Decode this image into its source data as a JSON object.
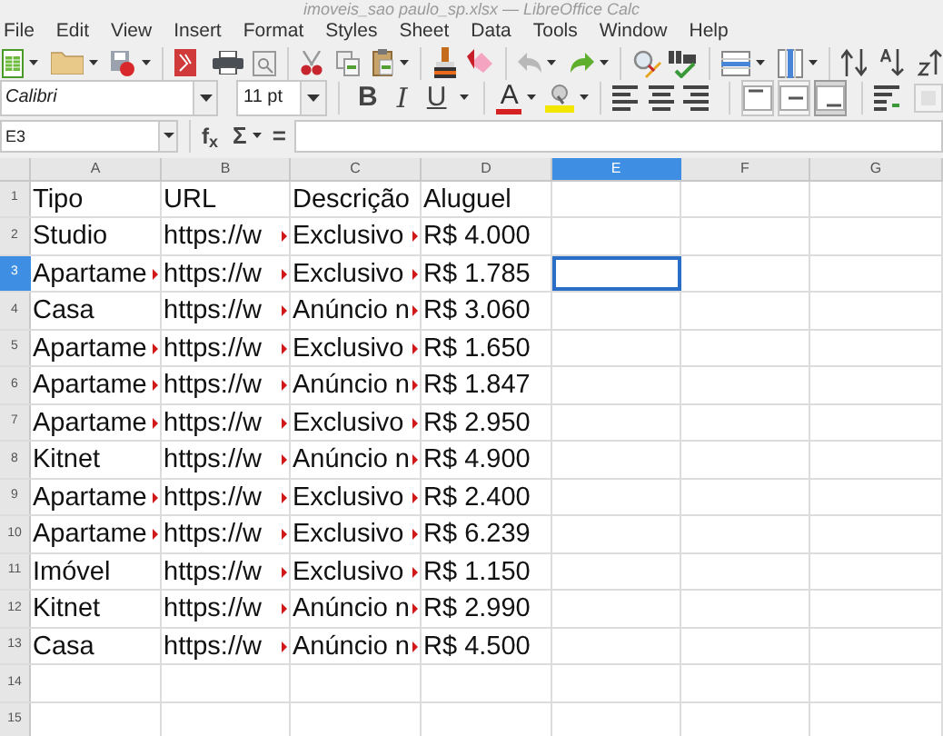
{
  "window": {
    "title": "imoveis_sao paulo_sp.xlsx — LibreOffice Calc"
  },
  "menu": [
    "File",
    "Edit",
    "View",
    "Insert",
    "Format",
    "Styles",
    "Sheet",
    "Data",
    "Tools",
    "Window",
    "Help"
  ],
  "toolbar": {
    "font_name": "Calibri",
    "font_size": "11 pt",
    "format_buttons": [
      {
        "label": "B",
        "kind": "bold"
      },
      {
        "label": "I",
        "kind": "italic"
      },
      {
        "label": "U",
        "kind": "underline"
      }
    ],
    "font_color_label": "A",
    "vertical_align": [
      {
        "selected": false
      },
      {
        "selected": false
      },
      {
        "selected": true
      }
    ]
  },
  "formula_bar": {
    "name_box": "E3",
    "function_wizard": "f$_{x}$",
    "sum": "Σ",
    "equals": "="
  },
  "sheet": {
    "columns": [
      {
        "label": "A",
        "selected": false
      },
      {
        "label": "B",
        "selected": false
      },
      {
        "label": "C",
        "selected": false
      },
      {
        "label": "D",
        "selected": false
      },
      {
        "label": "E",
        "selected": true
      },
      {
        "label": "F",
        "selected": false
      },
      {
        "label": "G",
        "selected": false
      }
    ],
    "rows": [
      {
        "number": "1",
        "selected": false,
        "cells": [
          {
            "text": "Tipo",
            "clipped": false
          },
          {
            "text": "URL",
            "clipped": false
          },
          {
            "text": "Descrição",
            "clipped": false
          },
          {
            "text": "Aluguel",
            "clipped": false
          }
        ]
      },
      {
        "number": "2",
        "selected": false,
        "cells": [
          {
            "text": "Studio",
            "clipped": false
          },
          {
            "text": "https://w",
            "clipped": true
          },
          {
            "text": "Exclusivo",
            "clipped": true
          },
          {
            "text": "R$ 4.000",
            "clipped": false
          }
        ]
      },
      {
        "number": "3",
        "selected": true,
        "cells": [
          {
            "text": "Apartame",
            "clipped": true
          },
          {
            "text": "https://w",
            "clipped": true
          },
          {
            "text": "Exclusivo",
            "clipped": true
          },
          {
            "text": "R$ 1.785",
            "clipped": false
          }
        ]
      },
      {
        "number": "4",
        "selected": false,
        "cells": [
          {
            "text": "Casa",
            "clipped": false
          },
          {
            "text": "https://w",
            "clipped": true
          },
          {
            "text": "Anúncio n",
            "clipped": true
          },
          {
            "text": "R$ 3.060",
            "clipped": false
          }
        ]
      },
      {
        "number": "5",
        "selected": false,
        "cells": [
          {
            "text": "Apartame",
            "clipped": true
          },
          {
            "text": "https://w",
            "clipped": true
          },
          {
            "text": "Exclusivo",
            "clipped": true
          },
          {
            "text": "R$ 1.650",
            "clipped": false
          }
        ]
      },
      {
        "number": "6",
        "selected": false,
        "cells": [
          {
            "text": "Apartame",
            "clipped": true
          },
          {
            "text": "https://w",
            "clipped": true
          },
          {
            "text": "Anúncio n",
            "clipped": true
          },
          {
            "text": "R$ 1.847",
            "clipped": false
          }
        ]
      },
      {
        "number": "7",
        "selected": false,
        "cells": [
          {
            "text": "Apartame",
            "clipped": true
          },
          {
            "text": "https://w",
            "clipped": true
          },
          {
            "text": "Exclusivo",
            "clipped": true
          },
          {
            "text": "R$ 2.950",
            "clipped": false
          }
        ]
      },
      {
        "number": "8",
        "selected": false,
        "cells": [
          {
            "text": "Kitnet",
            "clipped": false
          },
          {
            "text": "https://w",
            "clipped": true
          },
          {
            "text": "Anúncio n",
            "clipped": true
          },
          {
            "text": "R$ 4.900",
            "clipped": false
          }
        ]
      },
      {
        "number": "9",
        "selected": false,
        "cells": [
          {
            "text": "Apartame",
            "clipped": true
          },
          {
            "text": "https://w",
            "clipped": true
          },
          {
            "text": "Exclusivo",
            "clipped": true
          },
          {
            "text": "R$ 2.400",
            "clipped": false
          }
        ]
      },
      {
        "number": "10",
        "selected": false,
        "cells": [
          {
            "text": "Apartame",
            "clipped": true
          },
          {
            "text": "https://w",
            "clipped": true
          },
          {
            "text": "Exclusivo",
            "clipped": true
          },
          {
            "text": "R$ 6.239",
            "clipped": false
          }
        ]
      },
      {
        "number": "11",
        "selected": false,
        "cells": [
          {
            "text": "Imóvel",
            "clipped": false
          },
          {
            "text": "https://w",
            "clipped": true
          },
          {
            "text": "Exclusivo",
            "clipped": true
          },
          {
            "text": "R$ 1.150",
            "clipped": false
          }
        ]
      },
      {
        "number": "12",
        "selected": false,
        "cells": [
          {
            "text": "Kitnet",
            "clipped": false
          },
          {
            "text": "https://w",
            "clipped": true
          },
          {
            "text": "Anúncio n",
            "clipped": true
          },
          {
            "text": "R$ 2.990",
            "clipped": false
          }
        ]
      },
      {
        "number": "13",
        "selected": false,
        "cells": [
          {
            "text": "Casa",
            "clipped": false
          },
          {
            "text": "https://w",
            "clipped": true
          },
          {
            "text": "Anúncio n",
            "clipped": true
          },
          {
            "text": "R$ 4.500",
            "clipped": false
          }
        ]
      },
      {
        "number": "14",
        "selected": false,
        "cells": []
      },
      {
        "number": "15",
        "selected": false,
        "cells": []
      }
    ]
  }
}
